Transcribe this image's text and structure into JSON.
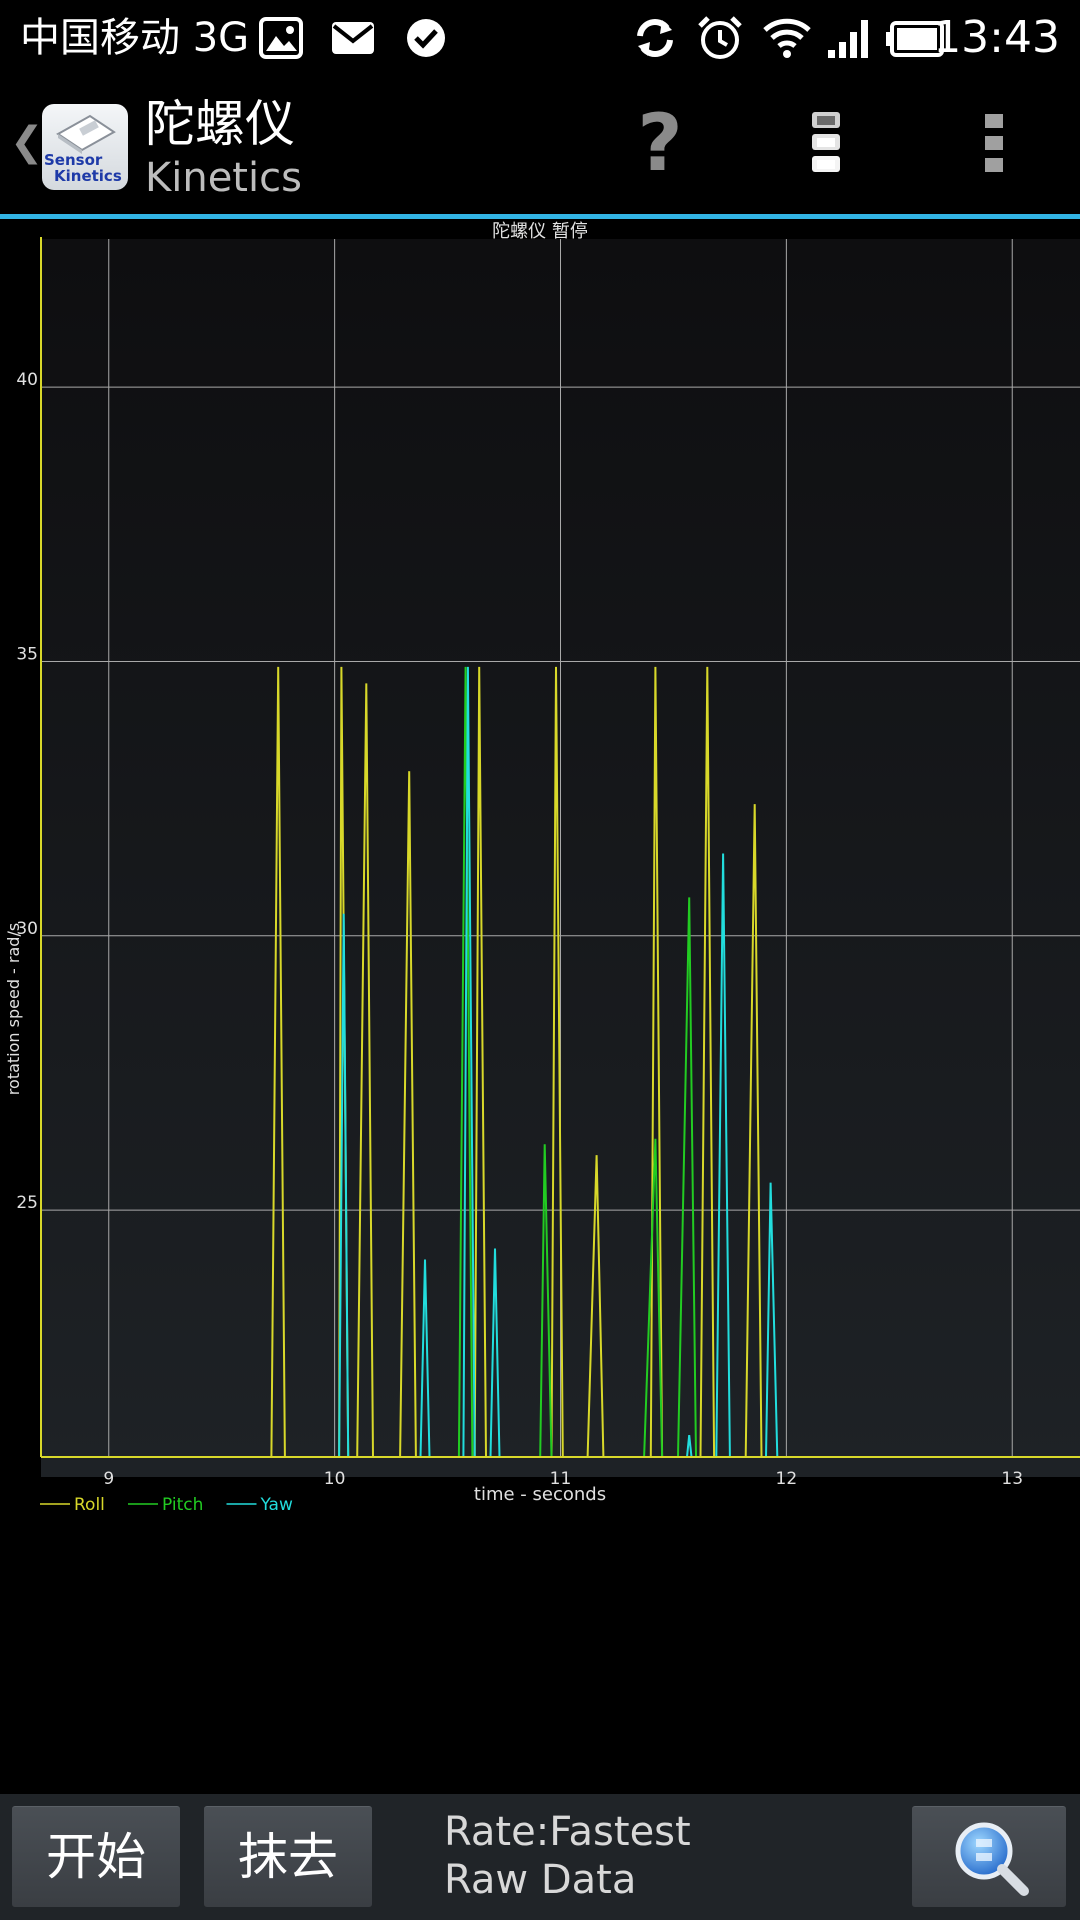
{
  "status_bar": {
    "carrier": "中国移动 3G",
    "time": "13:43",
    "icons": [
      "image-notification-icon",
      "mail-icon",
      "check-circle-icon",
      "sync-icon",
      "alarm-clock-icon",
      "wifi-icon",
      "cell-signal-icon",
      "battery-icon"
    ]
  },
  "action_bar": {
    "app_logo_text_line1": "Sensor",
    "app_logo_text_line2": "Kinetics",
    "title": "陀螺仪",
    "subtitle": "Kinetics",
    "help_label": "?"
  },
  "colors": {
    "accent": "#33b5e5",
    "roll": "#d8d82a",
    "pitch": "#22cc22",
    "yaw": "#22dddd",
    "grid": "#a9a9a9",
    "plot_bg_top": "#0e0e10",
    "plot_bg_bottom": "#1e2226"
  },
  "chart_data": {
    "type": "line",
    "title": "陀螺仪 暂停",
    "xlabel": "time - seconds",
    "ylabel": "rotation speed - rad/s",
    "xlim": [
      8.7,
      13.3
    ],
    "ylim": [
      20.5,
      42.7
    ],
    "x_ticks": [
      9,
      10,
      11,
      12,
      13
    ],
    "y_ticks": [
      25,
      30,
      35,
      40
    ],
    "grid": true,
    "legend_placement": "bottom-left",
    "series": [
      {
        "name": "Roll",
        "color": "#d8d82a",
        "points": [
          [
            8.7,
            20.5
          ],
          [
            9.72,
            20.5
          ],
          [
            9.75,
            34.9
          ],
          [
            9.78,
            20.5
          ],
          [
            10.02,
            20.5
          ],
          [
            10.03,
            34.9
          ],
          [
            10.06,
            20.5
          ],
          [
            10.1,
            20.5
          ],
          [
            10.14,
            34.6
          ],
          [
            10.17,
            20.5
          ],
          [
            10.29,
            20.5
          ],
          [
            10.33,
            33.0
          ],
          [
            10.36,
            20.5
          ],
          [
            10.62,
            20.5
          ],
          [
            10.64,
            34.9
          ],
          [
            10.67,
            20.5
          ],
          [
            10.96,
            20.5
          ],
          [
            10.98,
            34.9
          ],
          [
            11.01,
            20.5
          ],
          [
            11.12,
            20.5
          ],
          [
            11.16,
            26.0
          ],
          [
            11.19,
            20.5
          ],
          [
            11.4,
            20.5
          ],
          [
            11.42,
            34.9
          ],
          [
            11.45,
            20.5
          ],
          [
            11.62,
            20.5
          ],
          [
            11.65,
            34.9
          ],
          [
            11.68,
            20.5
          ],
          [
            11.82,
            20.5
          ],
          [
            11.86,
            32.4
          ],
          [
            11.89,
            20.5
          ],
          [
            13.3,
            20.5
          ]
        ]
      },
      {
        "name": "Pitch",
        "color": "#22cc22",
        "points": [
          [
            8.7,
            20.5
          ],
          [
            10.55,
            20.5
          ],
          [
            10.58,
            34.9
          ],
          [
            10.61,
            20.5
          ],
          [
            10.91,
            20.5
          ],
          [
            10.93,
            26.2
          ],
          [
            10.96,
            20.5
          ],
          [
            11.37,
            20.5
          ],
          [
            11.42,
            26.3
          ],
          [
            11.45,
            20.5
          ],
          [
            11.52,
            20.5
          ],
          [
            11.57,
            30.7
          ],
          [
            11.6,
            20.5
          ],
          [
            13.3,
            20.5
          ]
        ]
      },
      {
        "name": "Yaw",
        "color": "#22dddd",
        "points": [
          [
            8.7,
            20.5
          ],
          [
            10.02,
            20.5
          ],
          [
            10.04,
            30.4
          ],
          [
            10.06,
            20.5
          ],
          [
            10.38,
            20.5
          ],
          [
            10.4,
            24.1
          ],
          [
            10.42,
            20.5
          ],
          [
            10.57,
            20.5
          ],
          [
            10.59,
            34.9
          ],
          [
            10.62,
            20.5
          ],
          [
            10.69,
            20.5
          ],
          [
            10.71,
            24.3
          ],
          [
            10.73,
            20.5
          ],
          [
            11.56,
            20.5
          ],
          [
            11.57,
            20.9
          ],
          [
            11.58,
            20.5
          ],
          [
            11.69,
            20.5
          ],
          [
            11.72,
            31.5
          ],
          [
            11.75,
            20.5
          ],
          [
            11.91,
            20.5
          ],
          [
            11.93,
            25.5
          ],
          [
            11.96,
            20.5
          ],
          [
            13.3,
            20.5
          ]
        ]
      }
    ]
  },
  "bottom_bar": {
    "start_label": "开始",
    "clear_label": "抹去",
    "rate_line1": "Rate:Fastest",
    "rate_line2": "Raw Data"
  }
}
